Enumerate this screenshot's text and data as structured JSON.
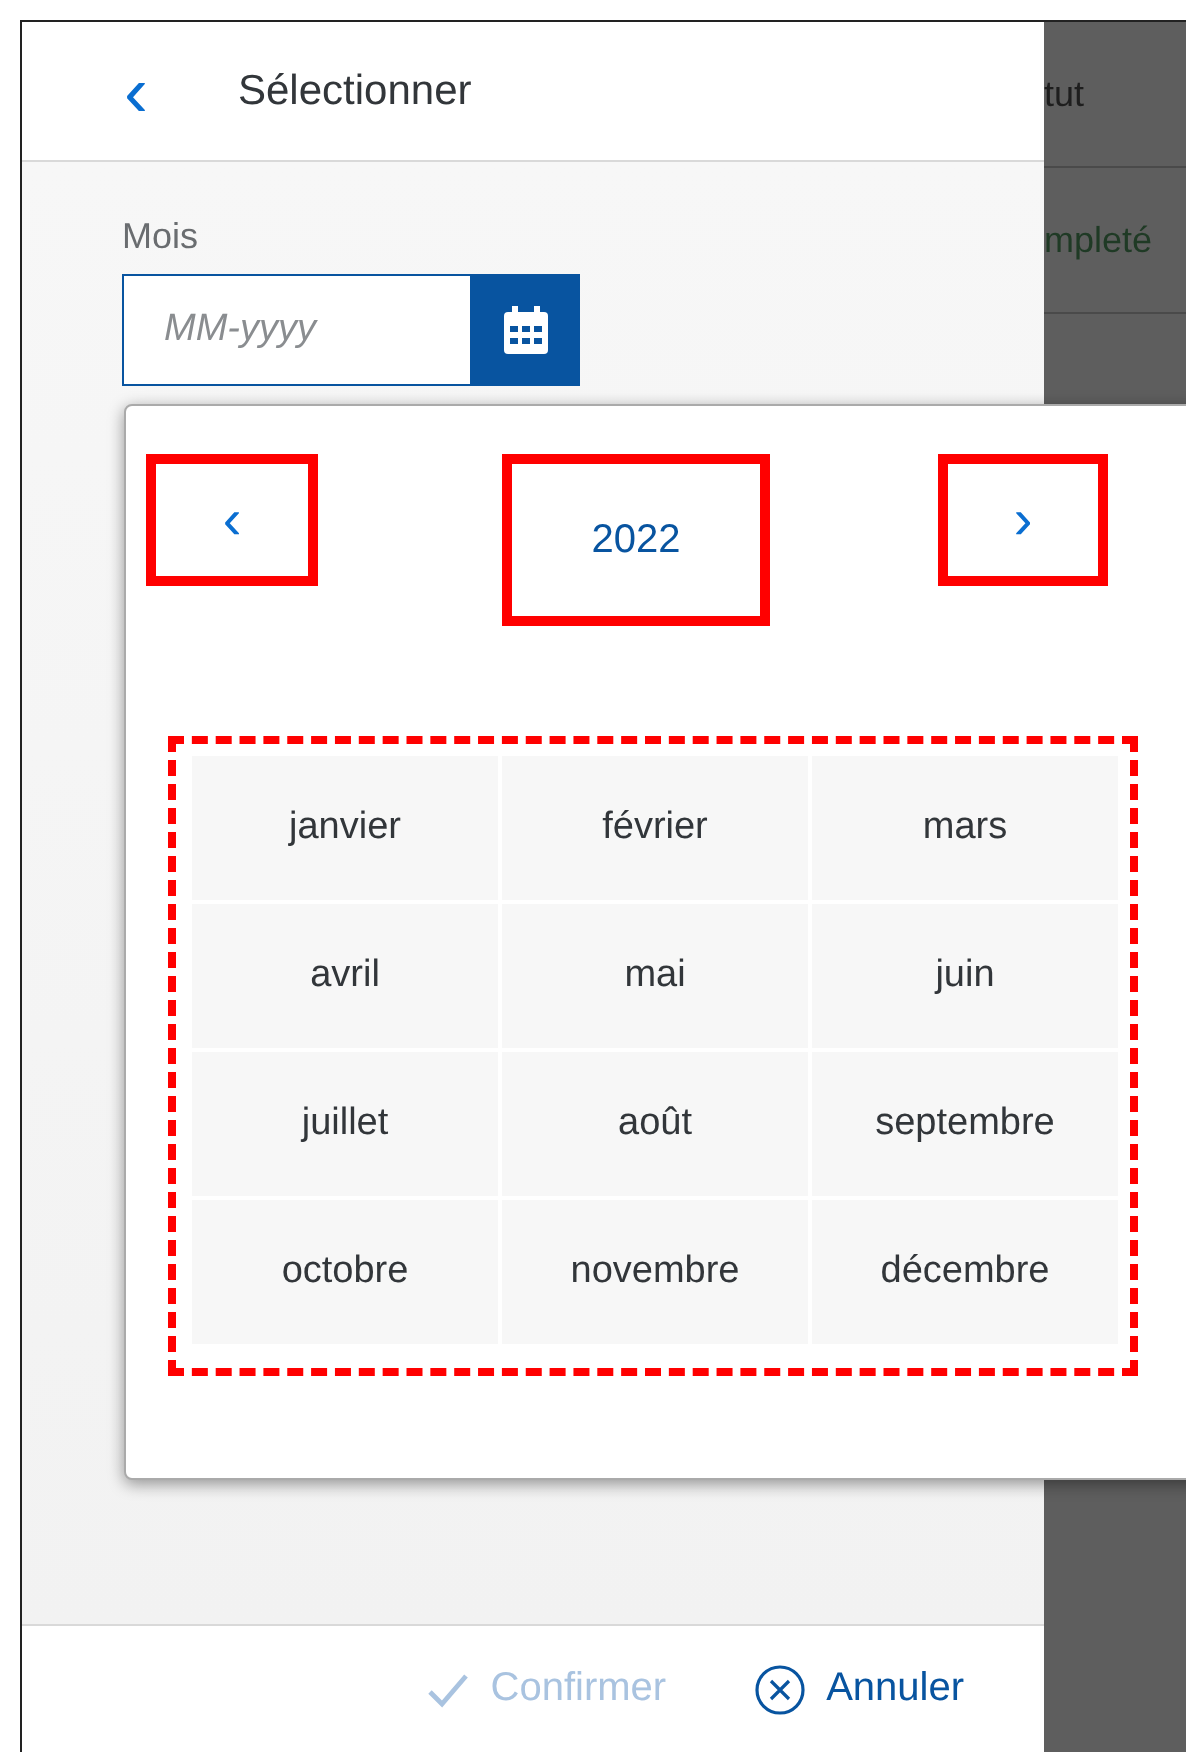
{
  "header": {
    "back_label": "‹",
    "title": "Sélectionner"
  },
  "field": {
    "label": "Mois",
    "placeholder": "MM-yyyy"
  },
  "picker": {
    "prev": {
      "label": "‹",
      "annotated": true
    },
    "year": {
      "label": "2022",
      "annotated": true
    },
    "next": {
      "label": "›",
      "annotated": true
    },
    "months_annotated": true,
    "months": [
      {
        "label": "janvier",
        "selected": false
      },
      {
        "label": "février",
        "selected": false
      },
      {
        "label": "mars",
        "selected": false
      },
      {
        "label": "avril",
        "selected": false
      },
      {
        "label": "mai",
        "selected": false
      },
      {
        "label": "juin",
        "selected": false
      },
      {
        "label": "juillet",
        "selected": false
      },
      {
        "label": "août",
        "selected": false
      },
      {
        "label": "septembre",
        "selected": false
      },
      {
        "label": "octobre",
        "selected": false
      },
      {
        "label": "novembre",
        "selected": false
      },
      {
        "label": "décembre",
        "selected": false
      }
    ]
  },
  "footer": {
    "buttons": [
      {
        "kind": "confirm",
        "label": "Confirmer",
        "disabled": true
      },
      {
        "kind": "cancel",
        "label": "Annuler",
        "disabled": false
      }
    ]
  },
  "background_table": {
    "cells": [
      "tut",
      "mpleté"
    ]
  }
}
